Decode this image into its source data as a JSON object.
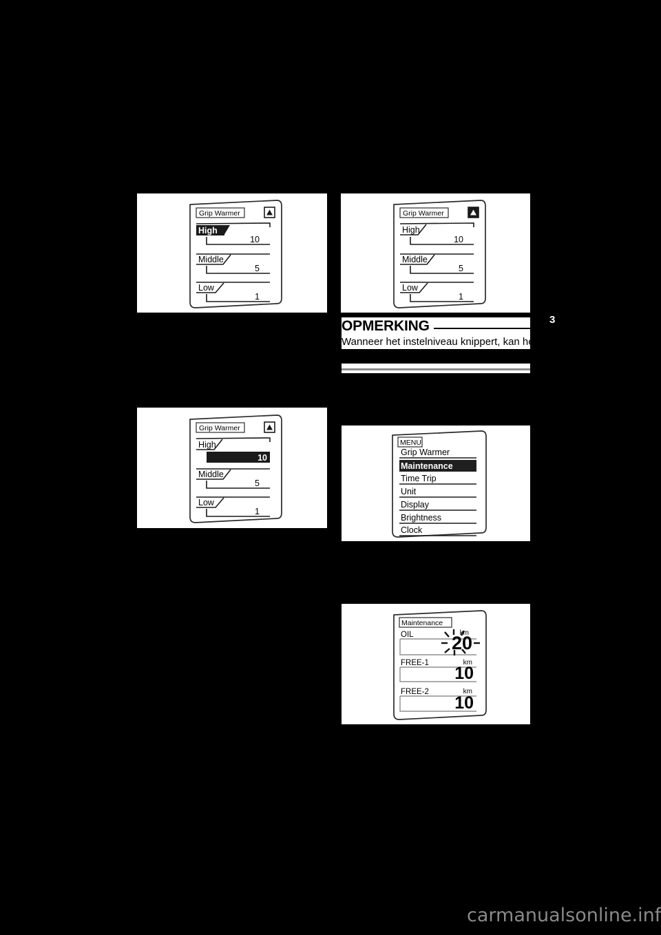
{
  "page": {
    "background_color": "#000000",
    "chapter_tab": "3",
    "watermark": "carmanualsonline.info"
  },
  "figures": [
    {
      "id": "grip-warmer-high-selected",
      "screen_title": "Grip Warmer",
      "indicator_icon": "triangle-up-outline",
      "rows": [
        {
          "label": "High",
          "value": "10",
          "label_highlighted": true,
          "value_highlighted": false
        },
        {
          "label": "Middle",
          "value": "5",
          "label_highlighted": false,
          "value_highlighted": false
        },
        {
          "label": "Low",
          "value": "1",
          "label_highlighted": false,
          "value_highlighted": false
        }
      ]
    },
    {
      "id": "grip-warmer-none-selected",
      "screen_title": "Grip Warmer",
      "indicator_icon": "triangle-up-filled",
      "rows": [
        {
          "label": "High",
          "value": "10",
          "label_highlighted": false,
          "value_highlighted": false
        },
        {
          "label": "Middle",
          "value": "5",
          "label_highlighted": false,
          "value_highlighted": false
        },
        {
          "label": "Low",
          "value": "1",
          "label_highlighted": false,
          "value_highlighted": false
        }
      ]
    },
    {
      "id": "grip-warmer-value-selected",
      "screen_title": "Grip Warmer",
      "indicator_icon": "triangle-up-outline",
      "rows": [
        {
          "label": "High",
          "value": "10",
          "label_highlighted": false,
          "value_highlighted": true
        },
        {
          "label": "Middle",
          "value": "5",
          "label_highlighted": false,
          "value_highlighted": false
        },
        {
          "label": "Low",
          "value": "1",
          "label_highlighted": false,
          "value_highlighted": false
        }
      ]
    }
  ],
  "menu_screen": {
    "id": "menu-list",
    "screen_title": "MENU",
    "items": [
      {
        "label": "Grip Warmer",
        "highlighted": false
      },
      {
        "label": "Maintenance",
        "highlighted": true
      },
      {
        "label": "Time Trip",
        "highlighted": false
      },
      {
        "label": "Unit",
        "highlighted": false
      },
      {
        "label": "Display",
        "highlighted": false
      },
      {
        "label": "Brightness",
        "highlighted": false
      },
      {
        "label": "Clock",
        "highlighted": false
      }
    ]
  },
  "maintenance_screen": {
    "id": "maintenance-list",
    "screen_title": "Maintenance",
    "rows": [
      {
        "label": "OIL",
        "unit": "km",
        "value": "20",
        "flashing": true
      },
      {
        "label": "FREE-1",
        "unit": "km",
        "value": "10",
        "flashing": false
      },
      {
        "label": "FREE-2",
        "unit": "km",
        "value": "10",
        "flashing": false
      }
    ]
  },
  "note": {
    "title": "OPMERKING",
    "body_line": "Wanneer het instelniveau knippert, kan het niveau worden gewijzigd."
  }
}
